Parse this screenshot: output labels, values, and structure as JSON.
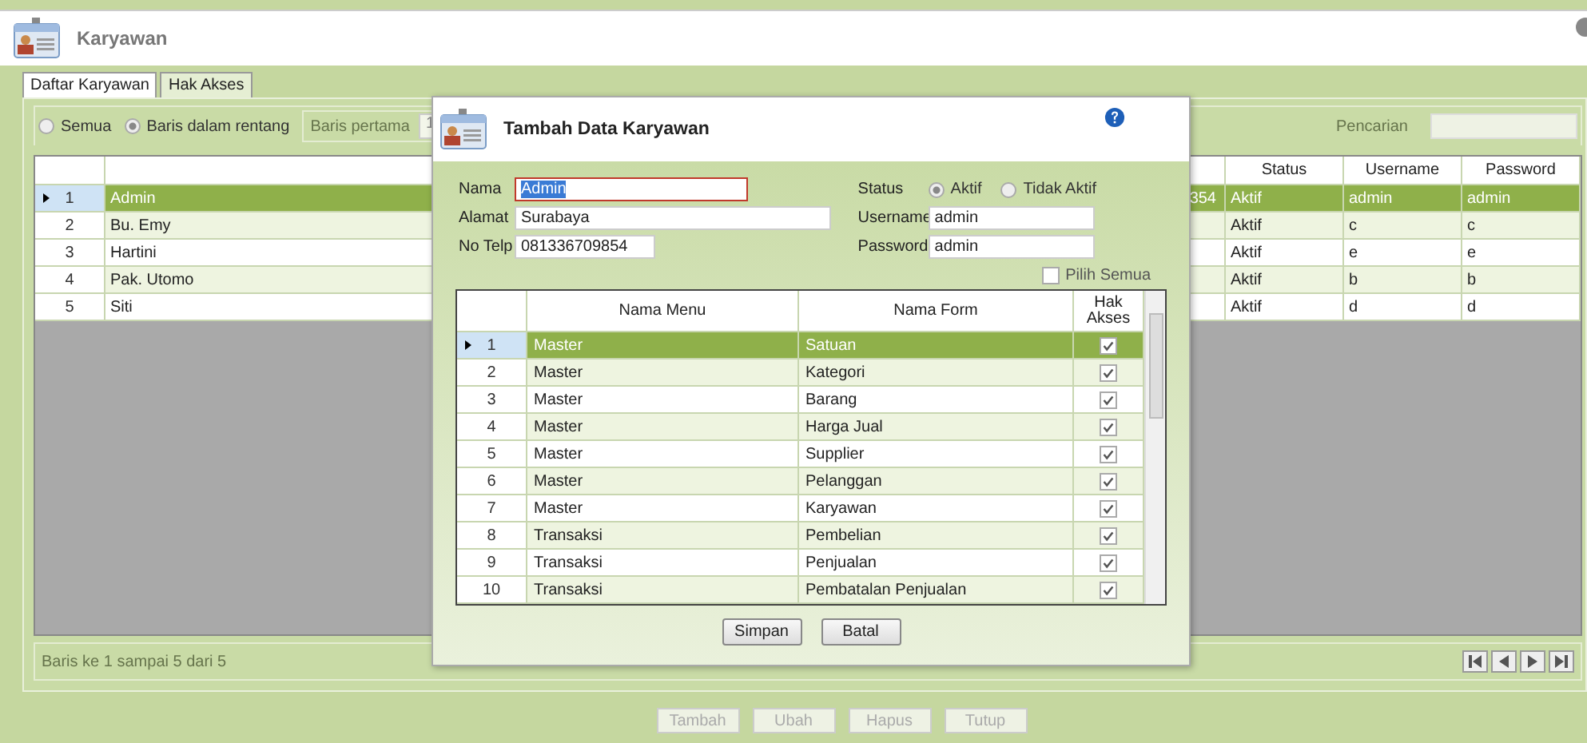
{
  "window": {
    "title": "Karyawan"
  },
  "tabs": [
    {
      "label": "Daftar Karyawan",
      "selected": true
    },
    {
      "label": "Hak Akses",
      "selected": false
    }
  ],
  "filter": {
    "options": [
      {
        "label": "Semua",
        "selected": false
      },
      {
        "label": "Baris dalam rentang",
        "selected": true
      }
    ],
    "first_row": {
      "label": "Baris pertama",
      "value": "1",
      "disabled": true
    },
    "search": {
      "label": "Pencarian"
    }
  },
  "table": {
    "columns": [
      "Status",
      "Username",
      "Password"
    ],
    "rows": [
      {
        "num": "1",
        "nama": "Admin",
        "column_3": "354",
        "status": "Aktif",
        "username": "admin",
        "password": "admin",
        "selected": true
      },
      {
        "num": "2",
        "nama": "Bu. Emy",
        "status": "Aktif",
        "username": "c",
        "password": "c",
        "selected": false
      },
      {
        "num": "3",
        "nama": "Hartini",
        "status": "Aktif",
        "username": "e",
        "password": "e",
        "selected": false
      },
      {
        "num": "4",
        "nama": "Pak. Utomo",
        "status": "Aktif",
        "username": "b",
        "password": "b",
        "selected": false
      },
      {
        "num": "5",
        "nama": "Siti",
        "status": "Aktif",
        "username": "d",
        "password": "d",
        "selected": false
      }
    ]
  },
  "status_bar": {
    "text": "Baris ke 1 sampai 5 dari 5"
  },
  "buttons": [
    {
      "label": "Tambah",
      "disabled": true
    },
    {
      "label": "Ubah",
      "disabled": true
    },
    {
      "label": "Hapus",
      "disabled": true
    },
    {
      "label": "Tutup",
      "disabled": true
    }
  ],
  "dialog": {
    "title": "Tambah Data Karyawan",
    "fields": [
      {
        "label": "Nama",
        "value": "Admin",
        "focused": true
      },
      {
        "label": "Alamat",
        "value": "Surabaya",
        "focused": false
      },
      {
        "label": "No Telp",
        "value": "081336709854",
        "focused": false
      }
    ],
    "status": {
      "label": "Status",
      "options": [
        {
          "label": "Aktif",
          "selected": true
        },
        {
          "label": "Tidak Aktif",
          "selected": false
        }
      ]
    },
    "account_fields": [
      {
        "label": "Username",
        "value": "admin"
      },
      {
        "label": "Password",
        "value": "admin"
      }
    ],
    "select_all": {
      "label": "Pilih Semua",
      "checked": false
    },
    "table": {
      "columns": [
        "Nama Menu",
        "Nama Form",
        "Hak Akses"
      ],
      "rows": [
        {
          "num": "1",
          "menu": "Master",
          "form": "Satuan",
          "checked": true,
          "selected": true
        },
        {
          "num": "2",
          "menu": "Master",
          "form": "Kategori",
          "checked": true,
          "selected": false
        },
        {
          "num": "3",
          "menu": "Master",
          "form": "Barang",
          "checked": true,
          "selected": false
        },
        {
          "num": "4",
          "menu": "Master",
          "form": "Harga Jual",
          "checked": true,
          "selected": false
        },
        {
          "num": "5",
          "menu": "Master",
          "form": "Supplier",
          "checked": true,
          "selected": false
        },
        {
          "num": "6",
          "menu": "Master",
          "form": "Pelanggan",
          "checked": true,
          "selected": false
        },
        {
          "num": "7",
          "menu": "Master",
          "form": "Karyawan",
          "checked": true,
          "selected": false
        },
        {
          "num": "8",
          "menu": "Transaksi",
          "form": "Pembelian",
          "checked": true,
          "selected": false
        },
        {
          "num": "9",
          "menu": "Transaksi",
          "form": "Penjualan",
          "checked": true,
          "selected": false
        },
        {
          "num": "10",
          "menu": "Transaksi",
          "form": "Pembatalan Penjualan",
          "checked": true,
          "selected": false
        }
      ]
    },
    "buttons": [
      "Simpan",
      "Batal"
    ]
  }
}
